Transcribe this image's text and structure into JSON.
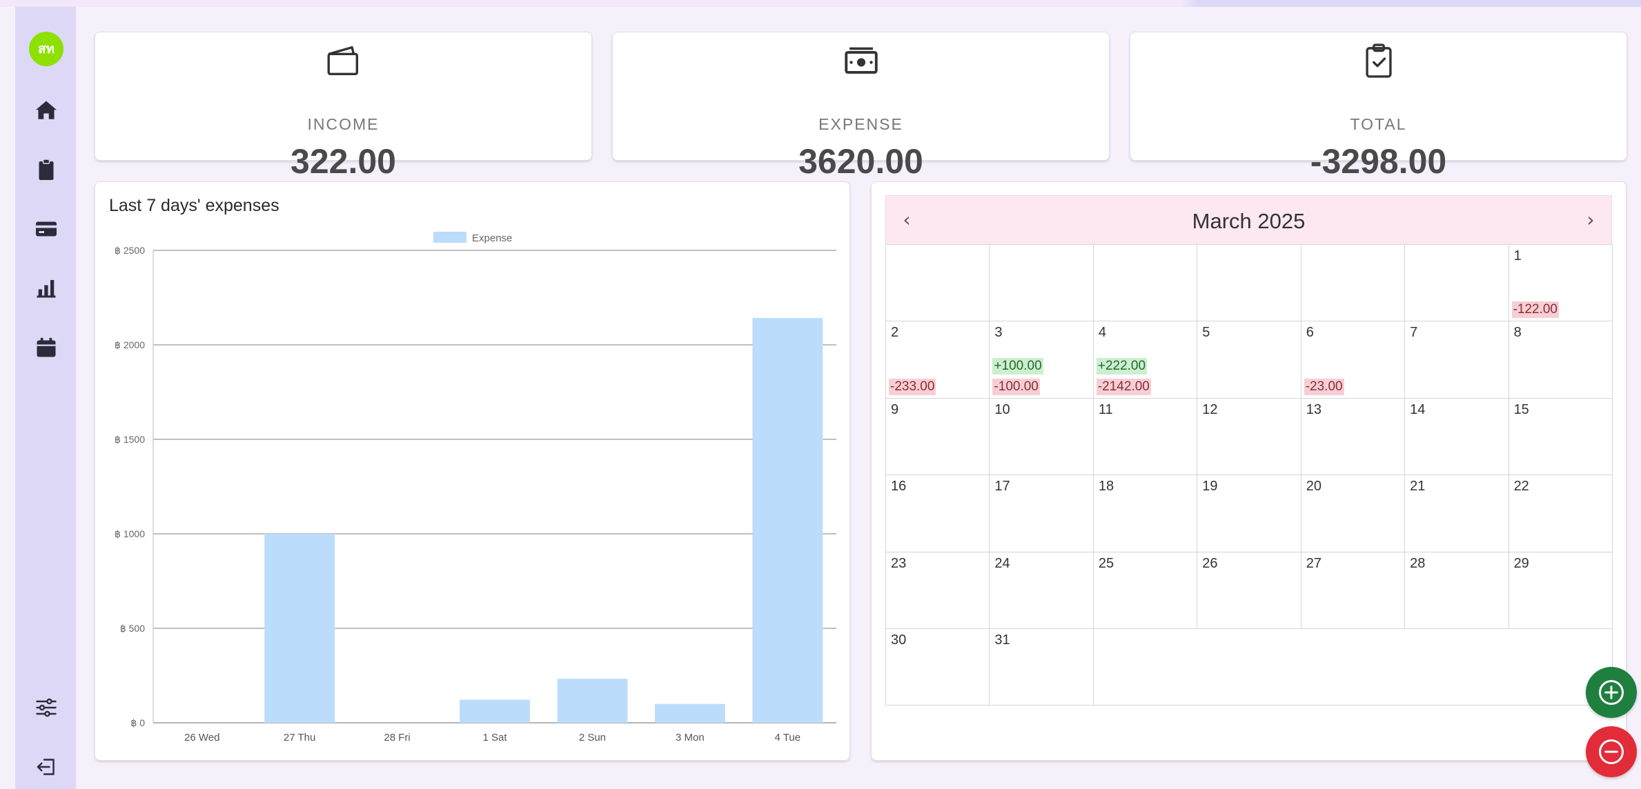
{
  "user": {
    "avatar_initials": "สท",
    "avatar_color": "#8ee000"
  },
  "sidebar": {
    "items": [
      {
        "icon": "home-icon"
      },
      {
        "icon": "clipboard-icon"
      },
      {
        "icon": "credit-card-icon"
      },
      {
        "icon": "bar-chart-icon"
      },
      {
        "icon": "calendar-icon"
      }
    ],
    "bottom": [
      {
        "icon": "settings-sliders-icon"
      },
      {
        "icon": "logout-icon"
      }
    ]
  },
  "summary": {
    "income": {
      "label": "INCOME",
      "value": "322.00",
      "icon": "wallet-icon"
    },
    "expense": {
      "label": "EXPENSE",
      "value": "3620.00",
      "icon": "money-icon"
    },
    "total": {
      "label": "TOTAL",
      "value": "-3298.00",
      "icon": "clipboard-check-icon"
    }
  },
  "chart_panel": {
    "title": "Last 7 days' expenses"
  },
  "chart_data": {
    "type": "bar",
    "title": "Last 7 days' expenses",
    "categories": [
      "26 Wed",
      "27 Thu",
      "28 Fri",
      "1 Sat",
      "2 Sun",
      "3 Mon",
      "4 Tue"
    ],
    "series": [
      {
        "name": "Expense",
        "values": [
          0,
          1000,
          0,
          122,
          233,
          100,
          2142
        ],
        "color": "#bcdcfb"
      }
    ],
    "ylim": [
      0,
      2500
    ],
    "yticks": [
      "฿ 0",
      "฿ 500",
      "฿ 1000",
      "฿ 1500",
      "฿ 2000",
      "฿ 2500"
    ],
    "legend": "top-center",
    "grid": true
  },
  "calendar": {
    "title": "March 2025",
    "prev": "‹",
    "next": "›",
    "weeks": [
      [
        {
          "day": ""
        },
        {
          "day": ""
        },
        {
          "day": ""
        },
        {
          "day": ""
        },
        {
          "day": ""
        },
        {
          "day": ""
        },
        {
          "day": "1",
          "expense": "-122.00"
        }
      ],
      [
        {
          "day": "2",
          "expense": "-233.00"
        },
        {
          "day": "3",
          "income": "+100.00",
          "expense": "-100.00"
        },
        {
          "day": "4",
          "income": "+222.00",
          "expense": "-2142.00"
        },
        {
          "day": "5"
        },
        {
          "day": "6",
          "expense": "-23.00"
        },
        {
          "day": "7"
        },
        {
          "day": "8"
        }
      ],
      [
        {
          "day": "9"
        },
        {
          "day": "10"
        },
        {
          "day": "11"
        },
        {
          "day": "12"
        },
        {
          "day": "13"
        },
        {
          "day": "14"
        },
        {
          "day": "15"
        }
      ],
      [
        {
          "day": "16"
        },
        {
          "day": "17"
        },
        {
          "day": "18"
        },
        {
          "day": "19"
        },
        {
          "day": "20"
        },
        {
          "day": "21"
        },
        {
          "day": "22"
        }
      ],
      [
        {
          "day": "23"
        },
        {
          "day": "24"
        },
        {
          "day": "25"
        },
        {
          "day": "26"
        },
        {
          "day": "27"
        },
        {
          "day": "28"
        },
        {
          "day": "29"
        }
      ],
      [
        {
          "day": "30"
        },
        {
          "day": "31"
        }
      ]
    ]
  },
  "actions": {
    "add_color": "#1f7f3f",
    "remove_color": "#e22c3a"
  }
}
